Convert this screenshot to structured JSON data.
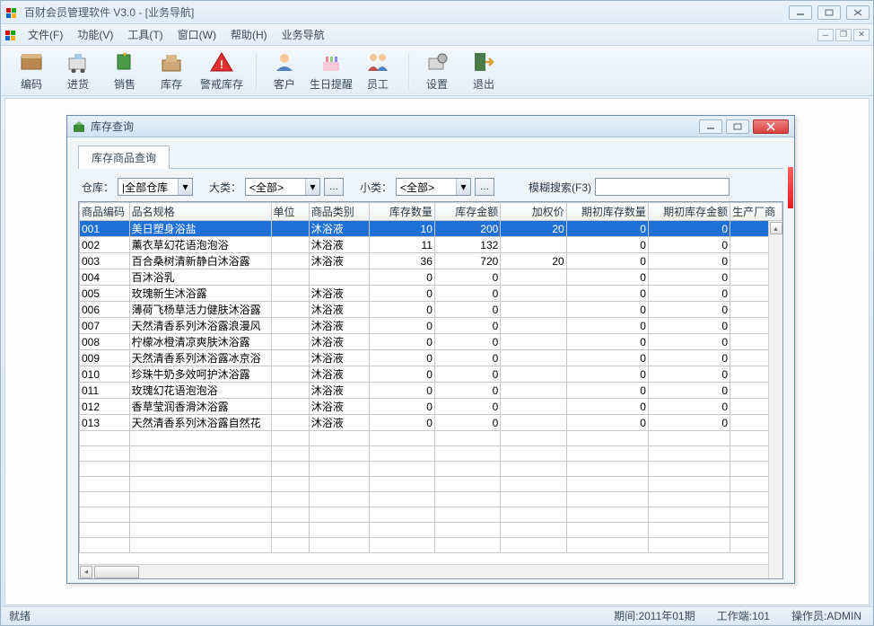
{
  "colors": {
    "accent": "#1e6fd6",
    "danger": "#d94040"
  },
  "main": {
    "title": "百财会员管理软件 V3.0 - [业务导航]",
    "menus": [
      "文件(F)",
      "功能(V)",
      "工具(T)",
      "窗口(W)",
      "帮助(H)",
      "业务导航"
    ],
    "toolbar": [
      {
        "id": "code",
        "label": "编码"
      },
      {
        "id": "purchase",
        "label": "进货"
      },
      {
        "id": "sales",
        "label": "销售"
      },
      {
        "id": "stock",
        "label": "库存"
      },
      {
        "id": "alert",
        "label": "警戒库存"
      },
      {
        "sep": true
      },
      {
        "id": "customer",
        "label": "客户"
      },
      {
        "id": "birthday",
        "label": "生日提醒"
      },
      {
        "id": "staff",
        "label": "员工"
      },
      {
        "sep": true
      },
      {
        "id": "settings",
        "label": "设置"
      },
      {
        "id": "exit",
        "label": "退出"
      }
    ]
  },
  "child": {
    "title": "库存查询",
    "tab": "库存商品查询",
    "filters": {
      "warehouse_label": "仓库：",
      "warehouse_value": "|全部仓库",
      "category_label": "大类：",
      "category_value": "<全部>",
      "subcategory_label": "小类：",
      "subcategory_value": "<全部>",
      "search_label": "模糊搜索(F3)",
      "search_value": ""
    },
    "columns": [
      "商品编码",
      "品名规格",
      "单位",
      "商品类别",
      "库存数量",
      "库存金额",
      "加权价",
      "期初库存数量",
      "期初库存金额",
      "生产厂商"
    ],
    "col_align": [
      "left",
      "left",
      "left",
      "left",
      "right",
      "right",
      "right",
      "right",
      "right",
      "left"
    ],
    "rows": [
      {
        "sel": true,
        "c": [
          "001",
          "美日塑身浴盐",
          "",
          "沐浴液",
          "10",
          "200",
          "20",
          "0",
          "0",
          ""
        ]
      },
      {
        "sel": false,
        "c": [
          "002",
          "薰衣草幻花语泡泡浴",
          "",
          "沐浴液",
          "11",
          "132",
          "",
          "0",
          "0",
          ""
        ]
      },
      {
        "sel": false,
        "c": [
          "003",
          "百合桑树清新静白沐浴露",
          "",
          "沐浴液",
          "36",
          "720",
          "20",
          "0",
          "0",
          ""
        ]
      },
      {
        "sel": false,
        "c": [
          "004",
          "百沐浴乳",
          "",
          "",
          "0",
          "0",
          "",
          "0",
          "0",
          ""
        ]
      },
      {
        "sel": false,
        "c": [
          "005",
          "玫瑰新生沐浴露",
          "",
          "沐浴液",
          "0",
          "0",
          "",
          "0",
          "0",
          ""
        ]
      },
      {
        "sel": false,
        "c": [
          "006",
          "薄荷飞杨草活力健肤沐浴露",
          "",
          "沐浴液",
          "0",
          "0",
          "",
          "0",
          "0",
          ""
        ]
      },
      {
        "sel": false,
        "c": [
          "007",
          "天然清香系列沐浴露浪漫风",
          "",
          "沐浴液",
          "0",
          "0",
          "",
          "0",
          "0",
          ""
        ]
      },
      {
        "sel": false,
        "c": [
          "008",
          "柠檬冰橙清凉爽肤沐浴露",
          "",
          "沐浴液",
          "0",
          "0",
          "",
          "0",
          "0",
          ""
        ]
      },
      {
        "sel": false,
        "c": [
          "009",
          "天然清香系列沐浴露冰京浴",
          "",
          "沐浴液",
          "0",
          "0",
          "",
          "0",
          "0",
          ""
        ]
      },
      {
        "sel": false,
        "c": [
          "010",
          "珍珠牛奶多效呵护沐浴露",
          "",
          "沐浴液",
          "0",
          "0",
          "",
          "0",
          "0",
          ""
        ]
      },
      {
        "sel": false,
        "c": [
          "011",
          "玫瑰幻花语泡泡浴",
          "",
          "沐浴液",
          "0",
          "0",
          "",
          "0",
          "0",
          ""
        ]
      },
      {
        "sel": false,
        "c": [
          "012",
          "香草莹润香滑沐浴露",
          "",
          "沐浴液",
          "0",
          "0",
          "",
          "0",
          "0",
          ""
        ]
      },
      {
        "sel": false,
        "c": [
          "013",
          "天然清香系列沐浴露自然花",
          "",
          "沐浴液",
          "0",
          "0",
          "",
          "0",
          "0",
          ""
        ]
      }
    ],
    "empty_rows": 8
  },
  "status": {
    "ready": "就绪",
    "period_label": "期间:",
    "period_value": "2011年01期",
    "terminal_label": "工作端:",
    "terminal_value": "101",
    "operator_label": "操作员:",
    "operator_value": "ADMIN"
  }
}
